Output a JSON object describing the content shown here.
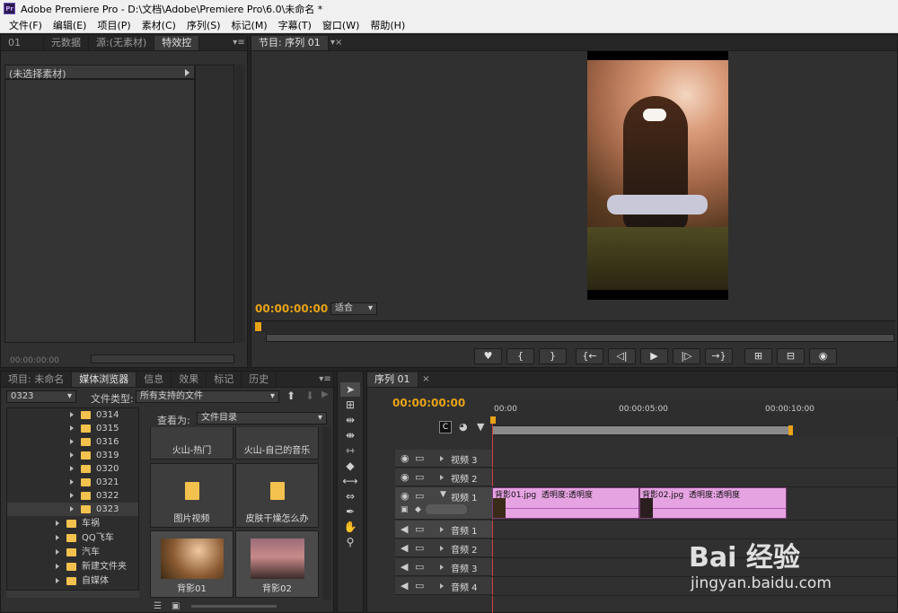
{
  "window": {
    "title": "Adobe Premiere Pro - D:\\文档\\Adobe\\Premiere Pro\\6.0\\未命名 *",
    "app_icon": "Pr"
  },
  "menu": [
    "文件(F)",
    "编辑(E)",
    "项目(P)",
    "素材(C)",
    "序列(S)",
    "标记(M)",
    "字幕(T)",
    "窗口(W)",
    "帮助(H)"
  ],
  "source_panel": {
    "tabs": [
      "01",
      "元数据",
      "源:(无素材)",
      "特效控"
    ],
    "header": "(未选择素材)",
    "timecode": "00:00:00:00"
  },
  "program_monitor": {
    "tab": "节目: 序列 01",
    "timecode": "00:00:00:00",
    "fit": "适合",
    "transport": [
      "♥",
      "{",
      "}",
      "{←",
      "◁|",
      "▶",
      "|▷",
      "→}",
      "⊞",
      "⊟",
      "◉"
    ]
  },
  "project_panel": {
    "tabs": [
      "项目: 未命名",
      "媒体浏览器",
      "信息",
      "效果",
      "标记",
      "历史"
    ],
    "path": "0323",
    "file_type_label": "文件类型:",
    "file_type_value": "所有支持的文件",
    "view_as_label": "查看为:",
    "view_as_value": "文件目录",
    "tree_sub": [
      "0314",
      "0315",
      "0316",
      "0319",
      "0320",
      "0321",
      "0322",
      "0323"
    ],
    "tree_top": [
      "车祸",
      "QQ飞车",
      "汽车",
      "新建文件夹",
      "自媒体"
    ],
    "thumbs": [
      "火山-热门",
      "火山-自己的音乐",
      "图片视频",
      "皮肤干燥怎么办",
      "背影01",
      "背影02"
    ]
  },
  "timeline": {
    "tab": "序列 01",
    "timecode": "00:00:00:00",
    "ruler": [
      "00:00",
      "00:00:05:00",
      "00:00:10:00"
    ],
    "video_tracks": [
      "视频 3",
      "视频 2",
      "视频 1"
    ],
    "audio_tracks": [
      "音频 1",
      "音频 2",
      "音频 3",
      "音频 4"
    ],
    "clips": [
      {
        "name": "背影01.jpg",
        "fx": "透明度:透明度"
      },
      {
        "name": "背影02.jpg",
        "fx": "透明度:透明度"
      }
    ]
  },
  "watermark": {
    "brand": "Bai 经验",
    "url": "jingyan.baidu.com"
  }
}
